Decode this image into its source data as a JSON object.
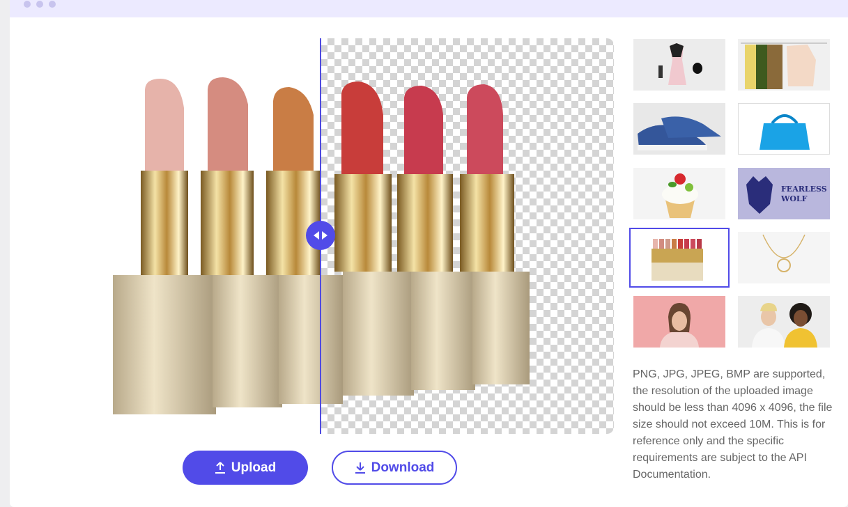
{
  "toolbar": {
    "upload_label": "Upload",
    "download_label": "Download"
  },
  "thumbnails": [
    {
      "name": "clothing-accessories"
    },
    {
      "name": "sweaters-rack"
    },
    {
      "name": "blue-sneakers"
    },
    {
      "name": "blue-handbag"
    },
    {
      "name": "cupcake"
    },
    {
      "name": "fearless-wolf-logo",
      "text": "FEARLESS WOLF"
    },
    {
      "name": "lipsticks",
      "selected": true
    },
    {
      "name": "rose-necklace"
    },
    {
      "name": "woman-pink-background"
    },
    {
      "name": "two-people"
    }
  ],
  "note": "PNG, JPG, JPEG, BMP are supported, the resolution of the uploaded image should be less than 4096 x 4096, the file size should not exceed 10M. This is for reference only and the specific requirements are subject to the API Documentation.",
  "colors": {
    "accent": "#514be8",
    "titlebar": "#eceaff"
  }
}
